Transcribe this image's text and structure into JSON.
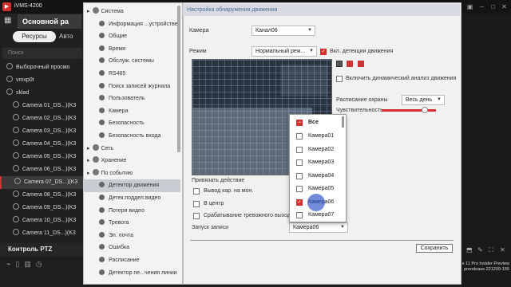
{
  "app": {
    "title": "iVMS-4200",
    "main_tab": "Основной ра"
  },
  "left_panel": {
    "tab_resources": "Ресурсы",
    "tab_auto": "Авто",
    "search_placeholder": "Поиск",
    "rows": [
      {
        "label": "Выборочный просмо",
        "type": "view"
      },
      {
        "label": "vmxp0t",
        "type": "group"
      },
      {
        "label": "sklad",
        "type": "group"
      },
      {
        "label": "Camera 01_DS...)(K3",
        "type": "camera"
      },
      {
        "label": "Camera 02_DS...)(K3",
        "type": "camera"
      },
      {
        "label": "Camera 03_DS...)(K3",
        "type": "camera"
      },
      {
        "label": "Camera 04_DS...)(K3",
        "type": "camera"
      },
      {
        "label": "Camera 05_DS...)(K3",
        "type": "camera"
      },
      {
        "label": "Camera 06_DS...)(K3",
        "type": "camera"
      },
      {
        "label": "Camera 07_DS...)(K3",
        "type": "camera",
        "selected": true
      },
      {
        "label": "Camera 08_DS...)(K3",
        "type": "camera"
      },
      {
        "label": "Camera 09_DS...)(K3",
        "type": "camera"
      },
      {
        "label": "Camera 10_DS...)(K3",
        "type": "camera"
      },
      {
        "label": "Camera 11_DS...)(K3",
        "type": "camera"
      }
    ],
    "ptz_title": "Контроль PTZ"
  },
  "tree": {
    "items": [
      {
        "label": "Система",
        "level": 0
      },
      {
        "label": "Информация ...устройстве:",
        "level": 1
      },
      {
        "label": "Общие",
        "level": 1
      },
      {
        "label": "Время",
        "level": 1
      },
      {
        "label": "Обслуж. системы",
        "level": 1
      },
      {
        "label": "RS485",
        "level": 1
      },
      {
        "label": "Поиск записей журнала",
        "level": 1
      },
      {
        "label": "Пользователь",
        "level": 1
      },
      {
        "label": "Камера",
        "level": 1
      },
      {
        "label": "Безопасность",
        "level": 1
      },
      {
        "label": "Безопасность входа",
        "level": 1
      },
      {
        "label": "Сеть",
        "level": 0
      },
      {
        "label": "Хранение",
        "level": 0
      },
      {
        "label": "По событию",
        "level": 0
      },
      {
        "label": "Детектор движения",
        "level": 1,
        "selected": true
      },
      {
        "label": "Детек.поддел.видео",
        "level": 1
      },
      {
        "label": "Потеря видео",
        "level": 1
      },
      {
        "label": "Тревога",
        "level": 1
      },
      {
        "label": "Эл. почта",
        "level": 1
      },
      {
        "label": "Ошибка",
        "level": 1
      },
      {
        "label": "Расписание",
        "level": 1
      },
      {
        "label": "Детектор пе...чения линии",
        "level": 1
      }
    ]
  },
  "content": {
    "heading": "Настройка обнаружения движения",
    "camera_label": "Камера",
    "camera_value": "Канал06",
    "mode_label": "Режим",
    "mode_value": "Нормальный реж...",
    "enable_detection_label": "Вкл. детекции движения",
    "enable_detection_checked": true,
    "dynamic_analysis_label": "Включить динамический анализ движения",
    "sensitivity_label": "Чувствительность",
    "sensitivity_level": 0.8,
    "schedule_label": "Расписание охраны",
    "schedule_value": "Весь день",
    "link_action_label": "Привязать действие",
    "actions": [
      {
        "label": "Вывод кар. на мон."
      },
      {
        "label": "В центр"
      },
      {
        "label": "Срабатывание тревожного выхода"
      }
    ],
    "record_label": "Запуск записи",
    "record_value": "Камера06",
    "save_label": "Сохранить"
  },
  "popup": {
    "all_label": "Все",
    "options": [
      {
        "label": "Камера01",
        "checked": false
      },
      {
        "label": "Камера02",
        "checked": false
      },
      {
        "label": "Камера03",
        "checked": false
      },
      {
        "label": "Камера04",
        "checked": false
      },
      {
        "label": "Камера05",
        "checked": false
      },
      {
        "label": "Камера06",
        "checked": true
      },
      {
        "label": "Камера07",
        "checked": false
      }
    ]
  },
  "notice": {
    "line1": "s 11 Pro Insider Preview",
    "line2": "prerelease.221209-155"
  },
  "colors": {
    "accent": "#d32f2f",
    "heading_text": "#4a6c9b"
  }
}
